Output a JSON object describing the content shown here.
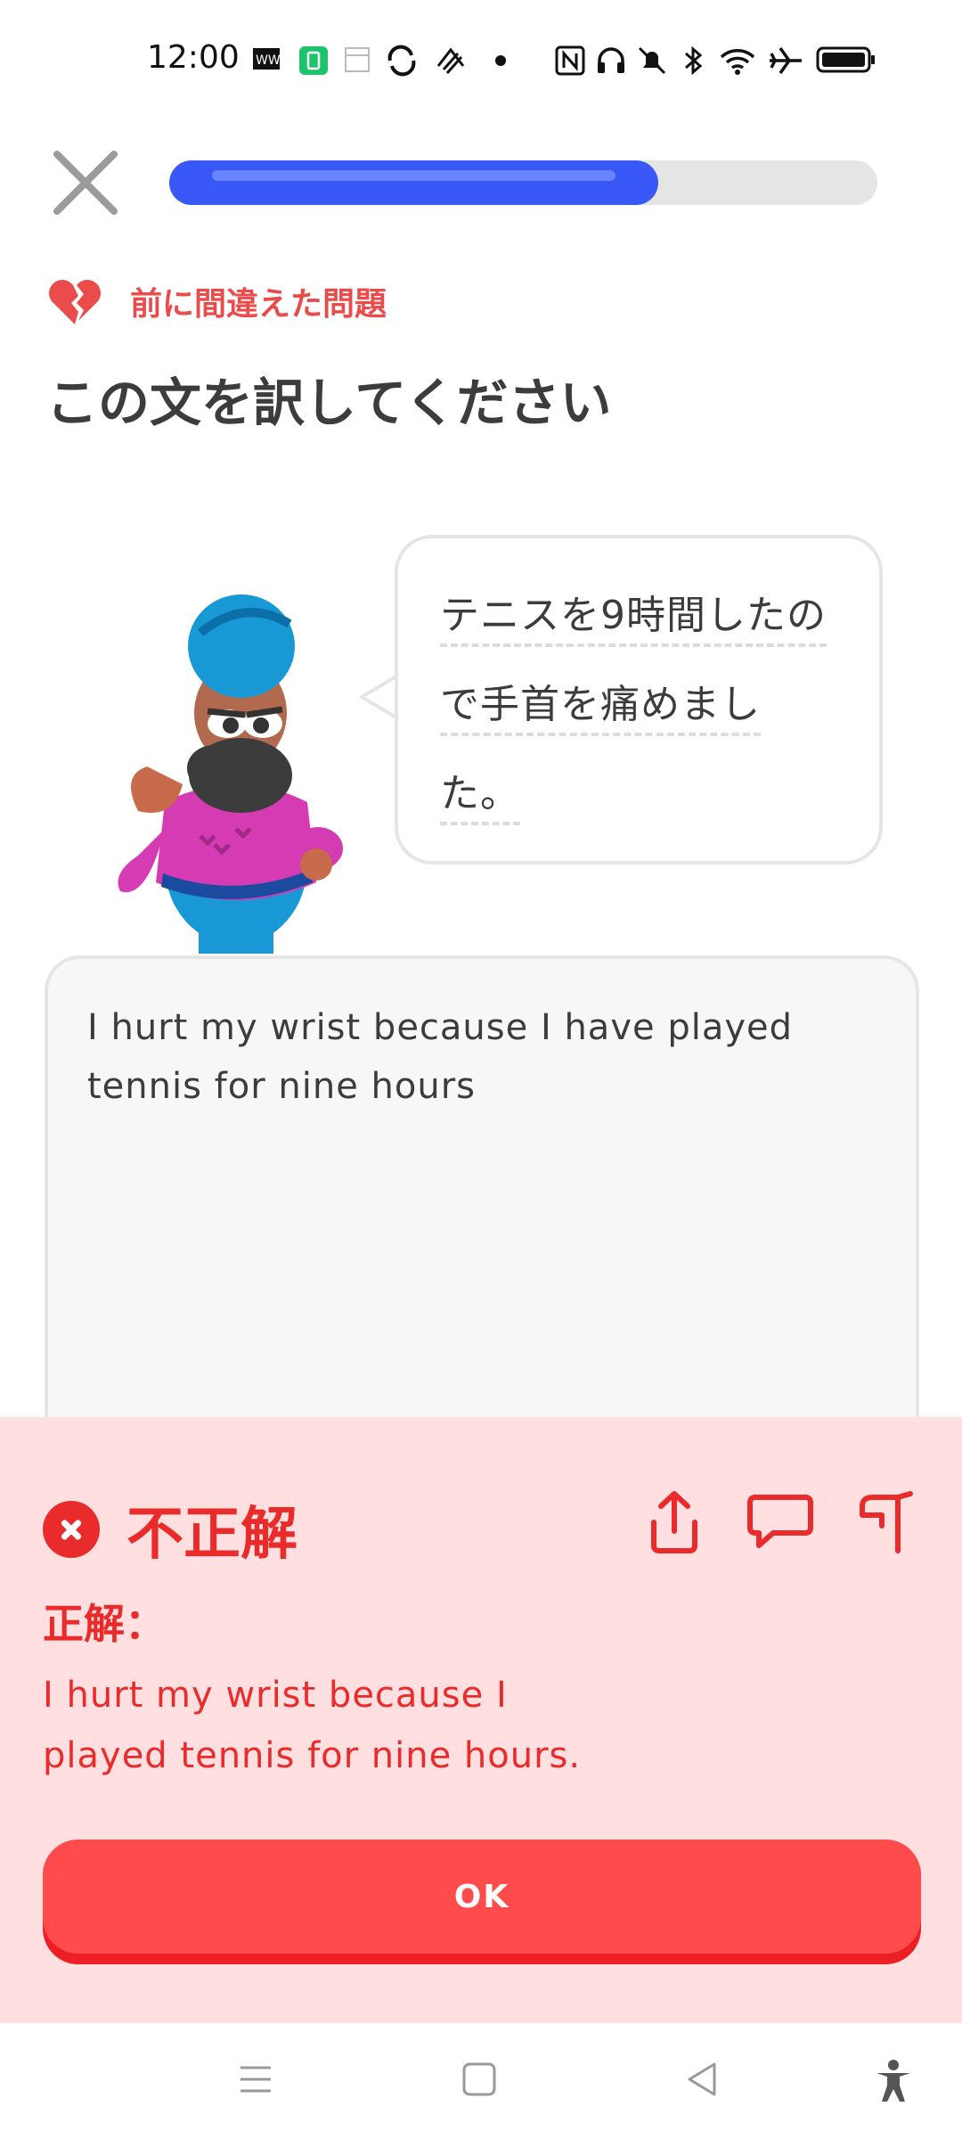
{
  "status_bar": {
    "time": "12:00",
    "icons": [
      "ww-icon",
      "battery-saver-icon",
      "calendar-icon",
      "sync-icon",
      "app-icon",
      "dot",
      "nfc-icon",
      "headphones-icon",
      "mute-icon",
      "bluetooth-icon",
      "wifi-icon",
      "airplane-icon",
      "battery-icon"
    ]
  },
  "lesson": {
    "progress_fraction": 0.69,
    "mistake_label": "前に間違えた問題",
    "prompt": "この文を訳してください"
  },
  "bubble": {
    "lines": [
      "テニスを9時間したの",
      "で手首を痛めまし",
      "た。"
    ]
  },
  "answer": {
    "text": "I hurt my wrist because I have played tennis for nine hours"
  },
  "feedback": {
    "title": "不正解",
    "correct_label": "正解：",
    "correct_text": "I hurt my wrist because I played tennis for nine hours.",
    "ok_label": "OK"
  },
  "colors": {
    "accent_blue": "#3a57f7",
    "error_red": "#ea2b2b",
    "feedback_bg": "#ffdfe0",
    "button_red": "#ff4b4b"
  }
}
